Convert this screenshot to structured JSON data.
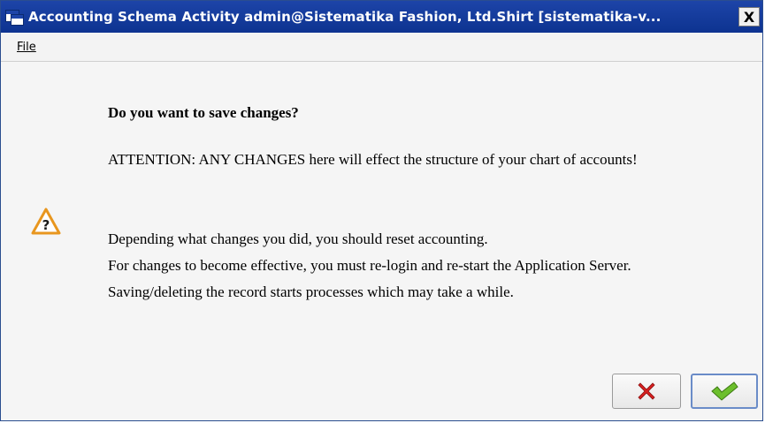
{
  "window": {
    "title": "Accounting Schema  Activity  admin@Sistematika Fashion, Ltd.Shirt [sistematika-v...",
    "close_label": "X"
  },
  "menu": {
    "file_label": "File"
  },
  "dialog": {
    "heading": "Do you want to save changes?",
    "attention": "ATTENTION: ANY CHANGES here will effect the structure of your chart of accounts!",
    "line1": "Depending what changes you did, you should reset accounting.",
    "line2": "For changes to become effective, you must re-login and re-start the Application Server.",
    "line3": "Saving/deleting the record starts processes which may take a while."
  },
  "buttons": {
    "cancel_icon": "red-x-icon",
    "ok_icon": "green-check-icon"
  },
  "colors": {
    "titlebar": "#1d44a8",
    "warning": "#f0a030",
    "cancel": "#d82020",
    "ok": "#5aa82a"
  }
}
